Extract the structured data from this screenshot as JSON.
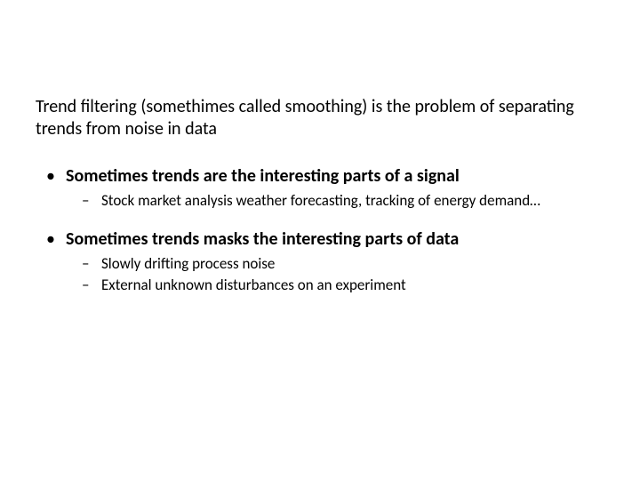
{
  "intro": "Trend filtering (somethimes called smoothing) is the problem of separating trends from noise in data",
  "bullets": [
    {
      "text": "Sometimes trends are the interesting parts of a signal",
      "sub": [
        "Stock market analysis weather forecasting, tracking of energy demand…"
      ]
    },
    {
      "text": "Sometimes trends masks the interesting parts of data",
      "sub": [
        "Slowly drifting process noise",
        "External unknown disturbances on an experiment"
      ]
    }
  ]
}
